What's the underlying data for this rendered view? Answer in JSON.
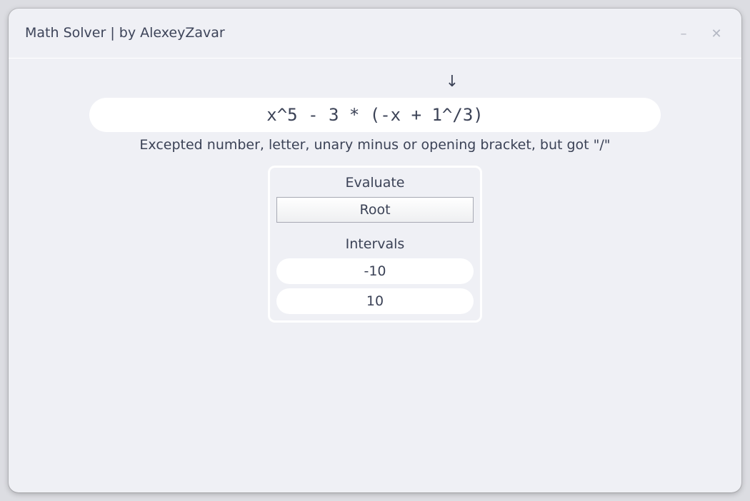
{
  "window": {
    "title": "Math Solver | by AlexeyZavar",
    "minimize_glyph": "–",
    "close_glyph": "✕"
  },
  "expression": {
    "value": "x^5 - 3 * (-x + 1^/3)",
    "error_marker": "↓",
    "error_message": "Excepted number, letter, unary minus or opening bracket, but got \"/\""
  },
  "panel": {
    "evaluate_label": "Evaluate",
    "evaluate_mode": "Root",
    "intervals_label": "Intervals",
    "interval_from": "-10",
    "interval_to": "10"
  },
  "colors": {
    "window_bg": "#eff0f5",
    "text": "#3b4256",
    "input_bg": "#ffffff",
    "window_controls": "#b4b8c3"
  },
  "icons": {
    "minimize": "minimize-icon",
    "close": "close-icon",
    "error_marker": "arrow-down-icon"
  }
}
